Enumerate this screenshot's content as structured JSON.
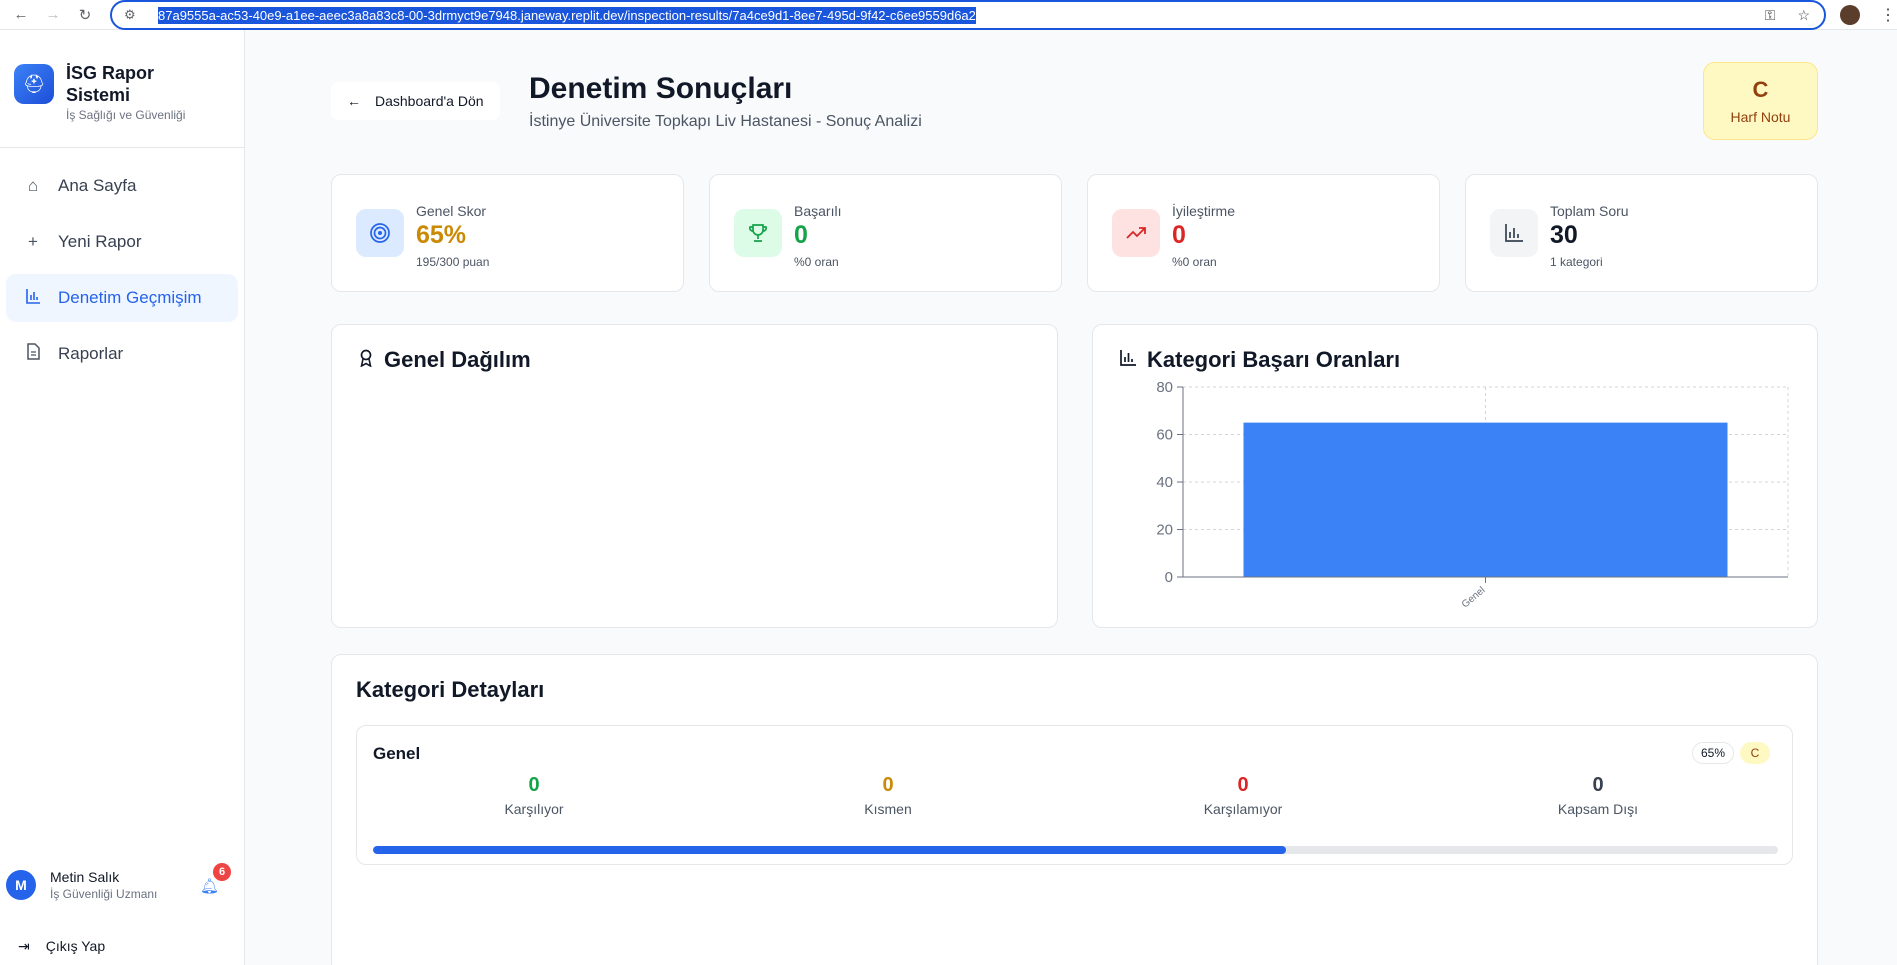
{
  "browser": {
    "url": "87a9555a-ac53-40e9-a1ee-aeec3a8a83c8-00-3drmyct9e7948.janeway.replit.dev/inspection-results/7a4ce9d1-8ee7-495d-9f42-c6ee9559d6a2"
  },
  "sidebar": {
    "brand_title": "İSG Rapor Sistemi",
    "brand_subtitle": "İş Sağlığı ve Güvenliği",
    "items": [
      {
        "label": "Ana Sayfa",
        "icon": "home-icon"
      },
      {
        "label": "Yeni Rapor",
        "icon": "plus-icon"
      },
      {
        "label": "Denetim Geçmişim",
        "icon": "bar-chart-icon",
        "active": true
      },
      {
        "label": "Raporlar",
        "icon": "document-icon"
      }
    ],
    "user": {
      "initial": "M",
      "name": "Metin Salık",
      "role": "İş Güvenliği Uzmanı",
      "notification_count": "6"
    },
    "logout_label": "Çıkış Yap"
  },
  "header": {
    "back_label": "Dashboard'a Dön",
    "title": "Denetim Sonuçları",
    "subtitle": "İstinye Üniversite Topkapı Liv Hastanesi - Sonuç Analizi",
    "grade_letter": "C",
    "grade_label": "Harf Notu"
  },
  "stats": [
    {
      "label": "Genel Skor",
      "value": "65%",
      "sub": "195/300 puan",
      "color": "#ca8a04",
      "icon": "target-icon"
    },
    {
      "label": "Başarılı",
      "value": "0",
      "sub": "%0 oran",
      "color": "#16a34a",
      "icon": "trophy-icon"
    },
    {
      "label": "İyileştirme",
      "value": "0",
      "sub": "%0 oran",
      "color": "#dc2626",
      "icon": "trending-up-icon"
    },
    {
      "label": "Toplam Soru",
      "value": "30",
      "sub": "1 kategori",
      "color": "#111827",
      "icon": "bar-chart-icon"
    }
  ],
  "distribution_panel": {
    "title": "Genel Dağılım"
  },
  "category_chart_panel": {
    "title": "Kategori Başarı Oranları"
  },
  "chart_data": {
    "type": "bar",
    "title": "Kategori Başarı Oranları",
    "categories": [
      "Genel"
    ],
    "values": [
      65
    ],
    "ylim": [
      0,
      80
    ],
    "yticks": [
      0,
      20,
      40,
      60,
      80
    ],
    "grid": true,
    "bar_color": "#3b82f6"
  },
  "category_details": {
    "title": "Kategori Detayları",
    "items": [
      {
        "name": "Genel",
        "percent_label": "65%",
        "grade": "C",
        "progress": 0.65,
        "stats": [
          {
            "value": "0",
            "label": "Karşılıyor",
            "color": "#16a34a"
          },
          {
            "value": "0",
            "label": "Kısmen",
            "color": "#ca8a04"
          },
          {
            "value": "0",
            "label": "Karşılamıyor",
            "color": "#dc2626"
          },
          {
            "value": "0",
            "label": "Kapsam Dışı",
            "color": "#374151"
          }
        ]
      }
    ]
  }
}
